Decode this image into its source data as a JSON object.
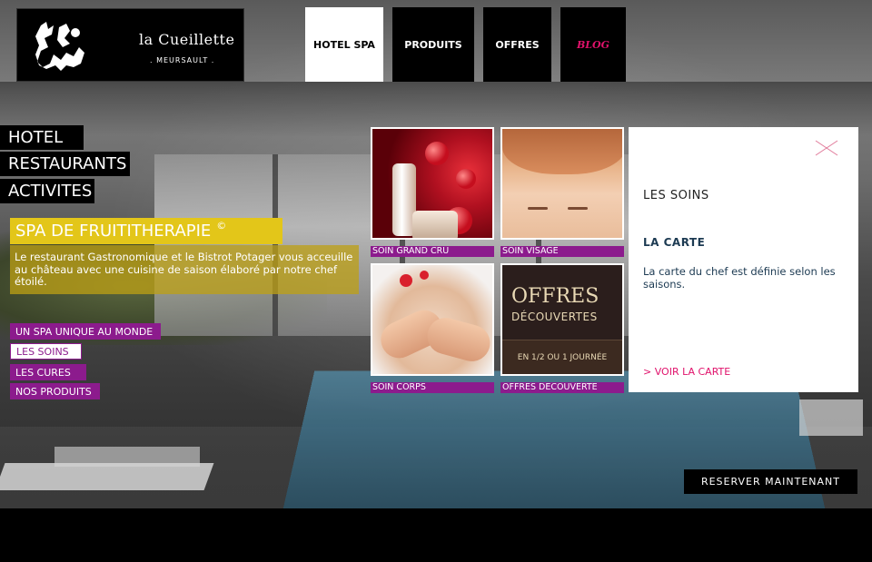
{
  "logo": {
    "name": "la Cueillette",
    "subtitle": ". MEURSAULT ."
  },
  "topnav": [
    {
      "label": "HOTEL SPA",
      "active": true
    },
    {
      "label": "PRODUITS"
    },
    {
      "label": "OFFRES"
    },
    {
      "label": "BLOG"
    }
  ],
  "leftmenu": [
    {
      "label": "HOTEL"
    },
    {
      "label": "RESTAURANTS"
    },
    {
      "label": "ACTIVITES"
    }
  ],
  "spa": {
    "title": "SPA DE FRUITITHERAPIE",
    "mark": "©",
    "description": "Le restaurant Gastronomique et le Bistrot Potager vous acceuille au château avec une cuisine de saison élaboré par notre chef étoilé."
  },
  "submenu": [
    {
      "label": "UN SPA UNIQUE AU MONDE"
    },
    {
      "label": "LES SOINS",
      "active": true
    },
    {
      "label": "LES CURES"
    },
    {
      "label": "NOS PRODUITS"
    }
  ],
  "tiles": [
    {
      "caption": "SOIN GRAND CRU"
    },
    {
      "caption": "SOIN VISAGE"
    },
    {
      "caption": "SOIN CORPS"
    },
    {
      "caption": "OFFRES DECOUVERTE",
      "title": "OFFRES",
      "subtitle": "DÉCOUVERTES",
      "band": "EN 1/2 OU 1 JOURNÉE"
    }
  ],
  "panel": {
    "heading": "LES SOINS",
    "subheading": "LA CARTE",
    "text": "La carte du chef est définie selon les saisons.",
    "link": "> VOIR LA CARTE"
  },
  "reserve_label": "RESERVER MAINTENANT",
  "colors": {
    "accent_purple": "#8c1b8d",
    "accent_yellow": "#e3c619",
    "accent_pink": "#e0126b"
  }
}
